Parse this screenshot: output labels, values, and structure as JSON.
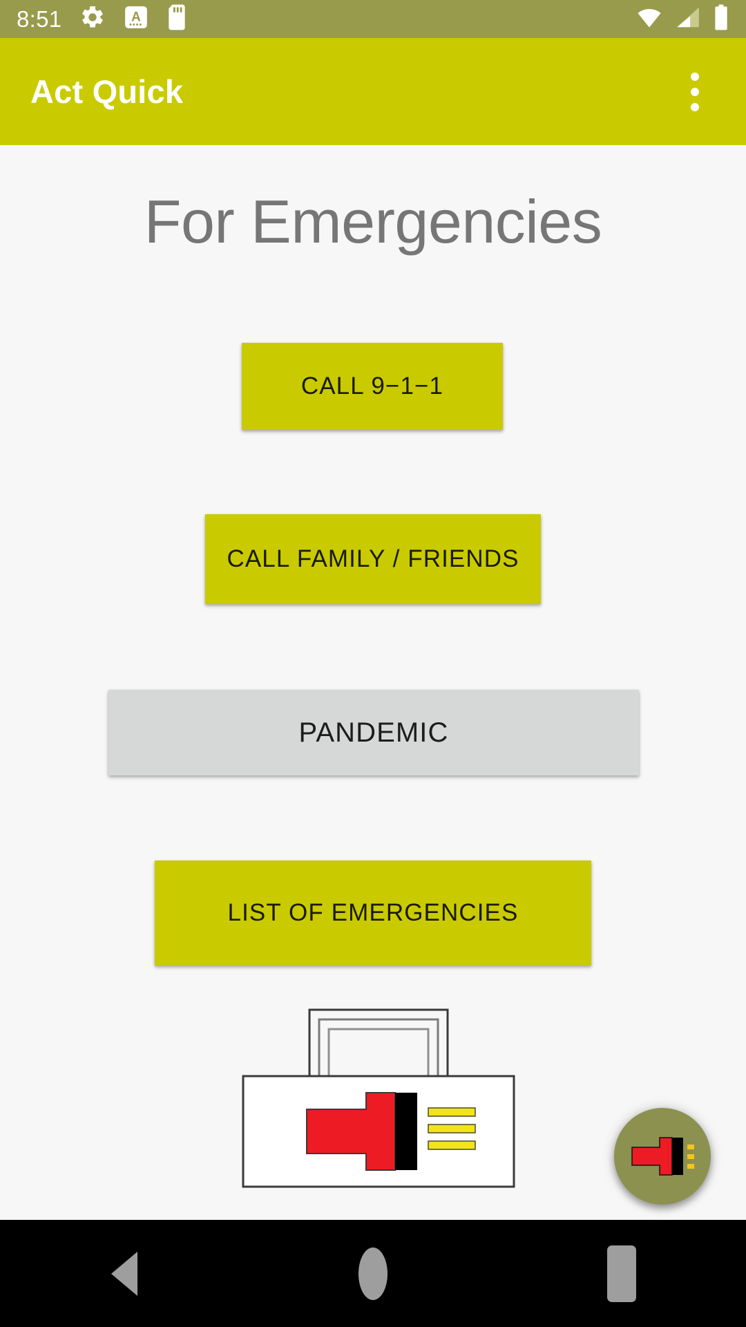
{
  "status_bar": {
    "time": "8:51",
    "left_icons": [
      "gear-icon",
      "font-size-a-icon",
      "sd-card-icon"
    ],
    "right_icons": [
      "wifi-icon",
      "cell-signal-icon",
      "battery-icon"
    ],
    "background_color": "#989a4c"
  },
  "app_bar": {
    "title": "Act Quick",
    "overflow_label": "More options",
    "background_color": "#c9cb00",
    "title_color": "#ffffff"
  },
  "main": {
    "heading": "For Emergencies",
    "heading_color": "#767676",
    "background_color": "#f7f7f7",
    "buttons": [
      {
        "label": "CALL 9−1−1",
        "style": "primary",
        "color": "#c9cb00"
      },
      {
        "label": "CALL FAMILY / FRIENDS",
        "style": "primary",
        "color": "#c9cb00"
      },
      {
        "label": "PANDEMIC",
        "style": "muted",
        "color": "#d6d7d7"
      },
      {
        "label": "LIST OF EMERGENCIES",
        "style": "primary",
        "color": "#c9cb00"
      }
    ],
    "logo": {
      "name": "first-aid-kit-logo",
      "case_color": "#ffffff",
      "cross_color": "#ed1c24",
      "bar_color": "#000000",
      "lines_color": "#f2e418"
    }
  },
  "fab": {
    "name": "app-logo-fab",
    "background_color": "#8c9150",
    "cross_color": "#ed1c24",
    "bar_color": "#000000",
    "lines_color": "#f5c518"
  },
  "nav_bar": {
    "background_color": "#000000",
    "icon_color": "#9e9e9e",
    "buttons": [
      {
        "name": "back-button",
        "icon": "triangle-left-icon"
      },
      {
        "name": "home-button",
        "icon": "circle-icon"
      },
      {
        "name": "recents-button",
        "icon": "square-icon"
      }
    ]
  }
}
